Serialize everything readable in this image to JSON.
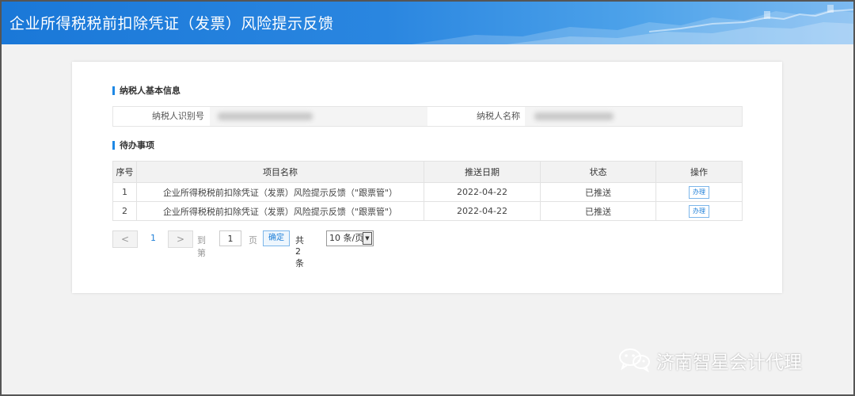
{
  "header": {
    "title": "企业所得税税前扣除凭证（发票）风险提示反馈"
  },
  "taxpayer_section": {
    "title": "纳税人基本信息",
    "id_label": "纳税人识别号",
    "name_label": "纳税人名称"
  },
  "todo_section": {
    "title": "待办事项",
    "columns": [
      "序号",
      "项目名称",
      "推送日期",
      "状态",
      "操作"
    ],
    "rows": [
      {
        "index": "1",
        "name": "企业所得税税前扣除凭证（发票）风险提示反馈（\"跟票管\"）",
        "date": "2022-04-22",
        "status": "已推送",
        "action": "办理"
      },
      {
        "index": "2",
        "name": "企业所得税税前扣除凭证（发票）风险提示反馈（\"跟票管\"）",
        "date": "2022-04-22",
        "status": "已推送",
        "action": "办理"
      }
    ]
  },
  "pager": {
    "prev": "<",
    "current_page": "1",
    "next": ">",
    "goto_label": "到第",
    "goto_value": "1",
    "page_unit": "页",
    "confirm": "确定",
    "total": "共 2 条",
    "page_size": "10 条/页"
  },
  "watermark": {
    "text": "济南智星会计代理",
    "icon": "wechat-icon"
  },
  "colors": {
    "header_blue": "#1a78d8",
    "accent": "#1e88e5",
    "link": "#1e7fd8"
  }
}
